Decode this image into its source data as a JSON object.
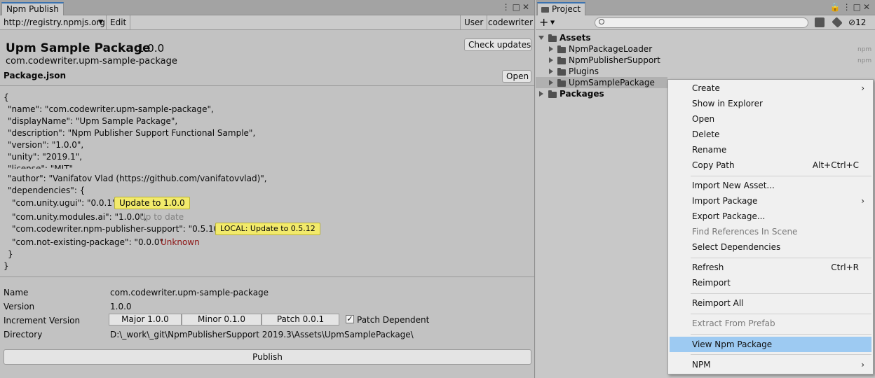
{
  "left": {
    "tab": "Npm Publish",
    "toolbar": {
      "registry": "http://registry.npmjs.org",
      "edit": "Edit",
      "user_label": "User",
      "user": "codewriter"
    },
    "package": {
      "title": "Upm Sample Package",
      "version": "1.0.0",
      "id": "com.codewriter.upm-sample-package",
      "check_updates": "Check updates",
      "json_label": "Package.json",
      "open": "Open"
    },
    "json": {
      "open_brace": "{",
      "name": "\"name\": \"com.codewriter.upm-sample-package\",",
      "displayName": "\"displayName\": \"Upm Sample Package\",",
      "description": "\"description\": \"Npm Publisher Support Functional Sample\",",
      "version": "\"version\": \"1.0.0\",",
      "unity": "\"unity\": \"2019.1\",",
      "license": "\"license\": \"MIT\",",
      "author": "\"author\": \"Vanifatov Vlad (https://github.com/vanifatovvlad)\",",
      "dependencies": "\"dependencies\": {",
      "deps": [
        {
          "text": "\"com.unity.ugui\": \"0.0.1\",",
          "status": "Update to 1.0.0"
        },
        {
          "text": "\"com.unity.modules.ai\": \"1.0.0\",",
          "status": "Up to date"
        },
        {
          "text": "\"com.codewriter.npm-publisher-support\": \"0.5.10\",",
          "status": "LOCAL: Update to 0.5.12"
        },
        {
          "text": "\"com.not-existing-package\": \"0.0.0\"",
          "status": "Unknown"
        }
      ],
      "close_deps": "}",
      "close_brace": "}"
    },
    "info": {
      "name_label": "Name",
      "name_value": "com.codewriter.upm-sample-package",
      "version_label": "Version",
      "version_value": "1.0.0",
      "increment_label": "Increment Version",
      "major": "Major 1.0.0",
      "minor": "Minor 0.1.0",
      "patch": "Patch 0.0.1",
      "patch_dependent": "Patch Dependent",
      "patch_dependent_checked": true,
      "directory_label": "Directory",
      "directory_value": "D:\\_work\\_git\\NpmPublisherSupport 2019.3\\Assets\\UpmSamplePackage\\"
    },
    "publish": "Publish"
  },
  "right": {
    "tab": "Project",
    "hidden_count": "12",
    "tree": {
      "assets": "Assets",
      "items": [
        {
          "label": "NpmPackageLoader",
          "tag": "npm"
        },
        {
          "label": "NpmPublisherSupport",
          "tag": "npm"
        },
        {
          "label": "Plugins",
          "tag": ""
        },
        {
          "label": "UpmSamplePackage",
          "tag": ""
        }
      ],
      "packages": "Packages"
    }
  },
  "menu": {
    "create": "Create",
    "show_in_explorer": "Show in Explorer",
    "open": "Open",
    "delete": "Delete",
    "rename": "Rename",
    "copy_path": "Copy Path",
    "copy_path_shortcut": "Alt+Ctrl+C",
    "import_new_asset": "Import New Asset...",
    "import_package": "Import Package",
    "export_package": "Export Package...",
    "find_references": "Find References In Scene",
    "select_dependencies": "Select Dependencies",
    "refresh": "Refresh",
    "refresh_shortcut": "Ctrl+R",
    "reimport": "Reimport",
    "reimport_all": "Reimport All",
    "extract_from_prefab": "Extract From Prefab",
    "view_npm_package": "View Npm Package",
    "npm": "NPM"
  },
  "colors": {
    "highlight": "#f2ea6b",
    "menu_selection": "#9dcaf2",
    "unknown_red": "#8c1414",
    "tab_accent": "#3a72b0"
  }
}
